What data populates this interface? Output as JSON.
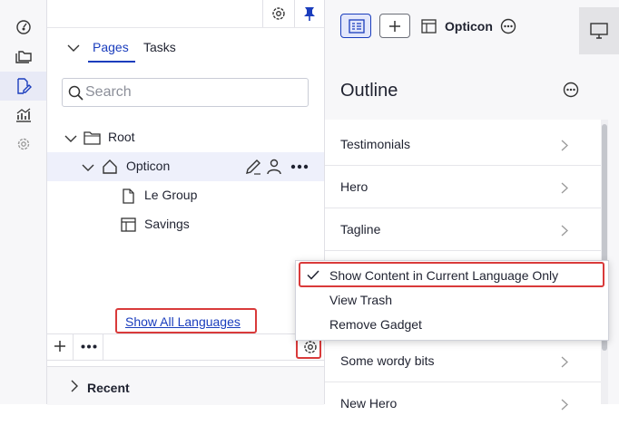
{
  "nav": {
    "tabs": [
      {
        "label": "Pages"
      },
      {
        "label": "Tasks"
      }
    ],
    "search": {
      "placeholder": "Search",
      "value": ""
    },
    "tree": [
      {
        "label": "Root"
      },
      {
        "label": "Opticon"
      },
      {
        "label": "Le Group"
      },
      {
        "label": "Savings"
      }
    ],
    "show_all_languages": "Show All Languages",
    "recent": "Recent"
  },
  "toolbar": {
    "context_title": "Opticon"
  },
  "outline": {
    "title": "Outline",
    "items": [
      {
        "label": "Testimonials"
      },
      {
        "label": "Hero"
      },
      {
        "label": "Tagline"
      },
      {
        "label": ""
      },
      {
        "label": ""
      },
      {
        "label": "Some wordy bits"
      },
      {
        "label": "New Hero"
      }
    ]
  },
  "menu": {
    "items": [
      {
        "label": "Show Content in Current Language Only",
        "checked": true
      },
      {
        "label": "View Trash"
      },
      {
        "label": "Remove Gadget"
      }
    ]
  },
  "colors": {
    "accent": "#1a3dbd",
    "highlight": "#d93a3a"
  }
}
